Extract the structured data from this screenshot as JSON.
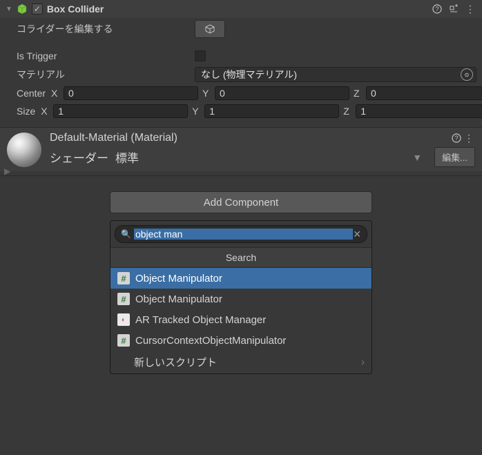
{
  "boxCollider": {
    "title": "Box Collider",
    "editLabel": "コライダーを編集する",
    "isTriggerLabel": "Is Trigger",
    "materialLabel": "マテリアル",
    "materialValue": "なし (物理マテリアル)",
    "centerLabel": "Center",
    "sizeLabel": "Size",
    "axes": {
      "x": "X",
      "y": "Y",
      "z": "Z"
    },
    "center": {
      "x": "0",
      "y": "0",
      "z": "0"
    },
    "size": {
      "x": "1",
      "y": "1",
      "z": "1"
    }
  },
  "material": {
    "title": "Default-Material (Material)",
    "shaderLabel": "シェーダー",
    "shaderValue": "標準",
    "editBtn": "編集..."
  },
  "addComponent": {
    "button": "Add Component",
    "searchValue": "object man",
    "popupTitle": "Search",
    "results": [
      {
        "label": "Object Manipulator",
        "icon": "script",
        "selected": true
      },
      {
        "label": "Object Manipulator",
        "icon": "script",
        "selected": false
      },
      {
        "label": "AR Tracked Object Manager",
        "icon": "ar",
        "selected": false
      },
      {
        "label": "CursorContextObjectManipulator",
        "icon": "script",
        "selected": false
      }
    ],
    "newScript": "新しいスクリプト"
  }
}
